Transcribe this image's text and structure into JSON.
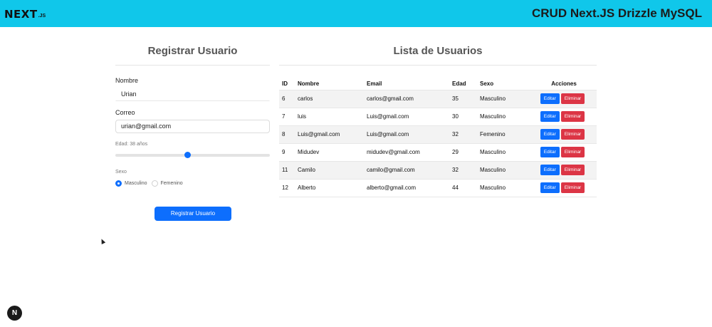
{
  "header": {
    "logo_text": "NEXT",
    "logo_sub": ".JS",
    "title": "CRUD Next.JS Drizzle MySQL",
    "color": "#10c7ea"
  },
  "form": {
    "title": "Registrar Usuario",
    "name_label": "Nombre",
    "name_value": "Urian",
    "email_label": "Correo",
    "email_value": "urian@gmail.com",
    "age_label": "Edad: 38 años",
    "age_value": 38,
    "age_fraction": 0.47,
    "sex_label": "Sexo",
    "sex_options": [
      "Masculino",
      "Femenino"
    ],
    "sex_selected": "Masculino",
    "submit_label": "Registrar Usuario"
  },
  "table": {
    "title": "Lista de Usuarios",
    "headers": {
      "id": "ID",
      "name": "Nombre",
      "email": "Email",
      "age": "Edad",
      "sex": "Sexo",
      "actions": "Acciones"
    },
    "edit_label": "Editar",
    "delete_label": "Eliminar",
    "rows": [
      {
        "id": "6",
        "name": "carlos",
        "email": "carlos@gmail.com",
        "age": "35",
        "sex": "Masculino"
      },
      {
        "id": "7",
        "name": "luis",
        "email": "Luis@gmail.com",
        "age": "30",
        "sex": "Masculino"
      },
      {
        "id": "8",
        "name": "Luis@gmail.com",
        "email": "Luis@gmail.com",
        "age": "32",
        "sex": "Femenino"
      },
      {
        "id": "9",
        "name": "Midudev",
        "email": "midudev@gmail.com",
        "age": "29",
        "sex": "Masculino"
      },
      {
        "id": "11",
        "name": "Camilo",
        "email": "camilo@gmail.com",
        "age": "32",
        "sex": "Masculino"
      },
      {
        "id": "12",
        "name": "Alberto",
        "email": "alberto@gmail.com",
        "age": "44",
        "sex": "Masculino"
      }
    ]
  },
  "badge": {
    "letter": "N"
  },
  "colors": {
    "primary": "#0d6efd",
    "danger": "#dc3545"
  }
}
